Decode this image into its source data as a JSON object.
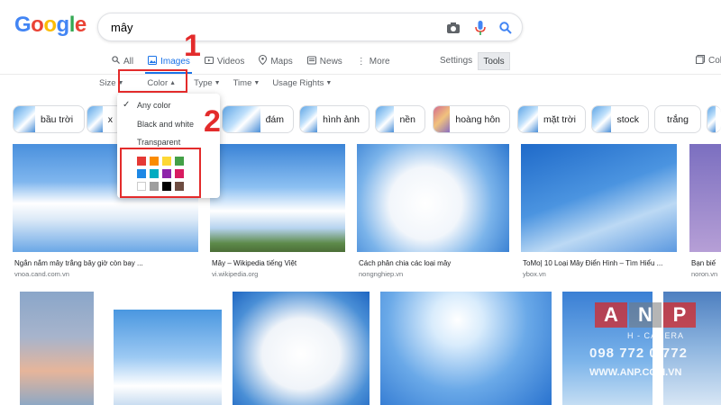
{
  "logo": {
    "letters": [
      "G",
      "o",
      "o",
      "g",
      "l",
      "e"
    ],
    "colors": [
      "#4285f4",
      "#ea4335",
      "#fbbc05",
      "#4285f4",
      "#34a853",
      "#ea4335"
    ]
  },
  "search": {
    "query": "mây"
  },
  "tabs": [
    {
      "label": "All",
      "icon": "search-icon"
    },
    {
      "label": "Images",
      "icon": "image-icon",
      "active": true
    },
    {
      "label": "Videos",
      "icon": "video-icon"
    },
    {
      "label": "Maps",
      "icon": "map-pin-icon"
    },
    {
      "label": "News",
      "icon": "news-icon"
    },
    {
      "label": "More",
      "icon": "more-icon"
    }
  ],
  "settings_label": "Settings",
  "tools_label": "Tools",
  "collections_label": "Col",
  "filters": [
    "Size",
    "Color",
    "Type",
    "Time",
    "Usage Rights"
  ],
  "chips": [
    "bầu trời",
    "x",
    "đám",
    "hình ảnh",
    "nền",
    "hoàng hôn",
    "mặt trời",
    "stock",
    "trắng"
  ],
  "color_menu": {
    "any_color": "Any color",
    "black_white": "Black and white",
    "transparent": "Transparent",
    "swatches": [
      "#e53935",
      "#fb8c00",
      "#fdd835",
      "#43a047",
      "#1e88e5",
      "#00acc1",
      "#8e24aa",
      "#d81b60",
      "#ffffff",
      "#9e9e9e",
      "#000000",
      "#6d4c41"
    ]
  },
  "annotations": [
    "1",
    "2"
  ],
  "results": [
    {
      "caption": "Ngắn nắm mây trắng bây giờ còn bay ...",
      "source": "vnoa.cand.com.vn"
    },
    {
      "caption": "Mây – Wikipedia tiếng Việt",
      "source": "vi.wikipedia.org"
    },
    {
      "caption": "Cách phân chia các loại mây",
      "source": "nongnghiep.vn"
    },
    {
      "caption": "ToMo| 10 Loại Mây Điển Hình – Tìm Hiểu ...",
      "source": "ybox.vn"
    },
    {
      "caption": "Bạn biế",
      "source": "noron.vn"
    }
  ],
  "watermark": {
    "letters": [
      "A",
      "N",
      "P"
    ],
    "sub": "H - CAMERA",
    "phone": "098 772 0 772",
    "site": "WWW.ANP.COM.VN"
  }
}
